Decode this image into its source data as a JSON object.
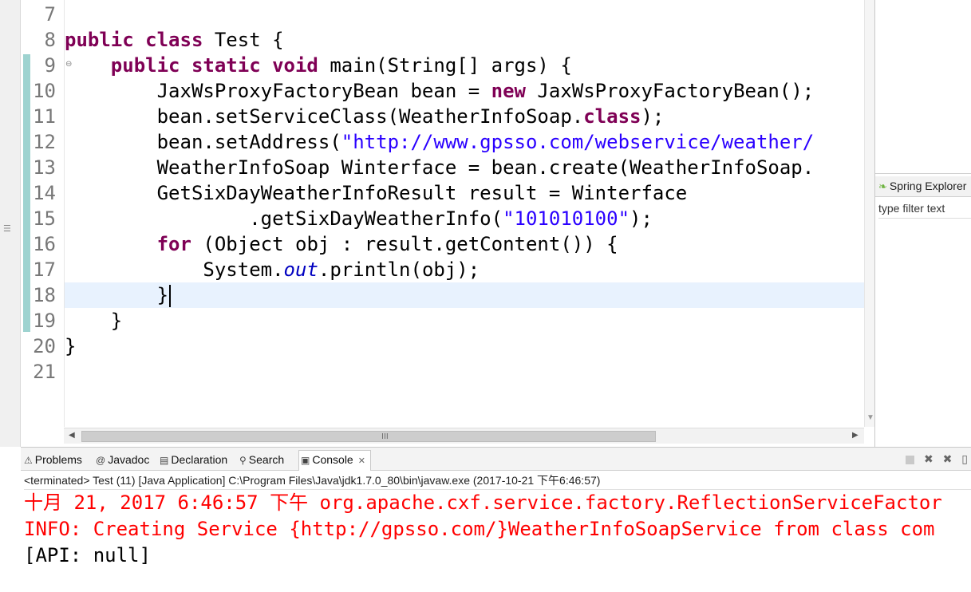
{
  "editor": {
    "lines": [
      {
        "num": "7",
        "segments": []
      },
      {
        "num": "8",
        "segments": [
          {
            "t": "public class",
            "c": "kw"
          },
          {
            "t": " Test {",
            "c": ""
          }
        ]
      },
      {
        "num": "9",
        "segments": [
          {
            "t": "    ",
            "c": ""
          },
          {
            "t": "public static void",
            "c": "kw"
          },
          {
            "t": " main(String[] args) {",
            "c": ""
          }
        ]
      },
      {
        "num": "10",
        "segments": [
          {
            "t": "        JaxWsProxyFactoryBean bean = ",
            "c": ""
          },
          {
            "t": "new",
            "c": "kw"
          },
          {
            "t": " JaxWsProxyFactoryBean();",
            "c": ""
          }
        ]
      },
      {
        "num": "11",
        "segments": [
          {
            "t": "        bean.setServiceClass(WeatherInfoSoap.",
            "c": ""
          },
          {
            "t": "class",
            "c": "kw"
          },
          {
            "t": ");",
            "c": ""
          }
        ]
      },
      {
        "num": "12",
        "segments": [
          {
            "t": "        bean.setAddress(",
            "c": ""
          },
          {
            "t": "\"http://www.gpsso.com/webservice/weather/",
            "c": "str"
          }
        ]
      },
      {
        "num": "13",
        "segments": [
          {
            "t": "        WeatherInfoSoap Winterface = bean.create(WeatherInfoSoap.",
            "c": ""
          }
        ]
      },
      {
        "num": "14",
        "segments": [
          {
            "t": "        GetSixDayWeatherInfoResult result = Winterface",
            "c": ""
          }
        ]
      },
      {
        "num": "15",
        "segments": [
          {
            "t": "                .getSixDayWeatherInfo(",
            "c": ""
          },
          {
            "t": "\"101010100\"",
            "c": "str"
          },
          {
            "t": ");",
            "c": ""
          }
        ]
      },
      {
        "num": "16",
        "segments": [
          {
            "t": "        ",
            "c": ""
          },
          {
            "t": "for",
            "c": "kw"
          },
          {
            "t": " (Object obj : result.getContent()) {",
            "c": ""
          }
        ]
      },
      {
        "num": "17",
        "segments": [
          {
            "t": "            System.",
            "c": ""
          },
          {
            "t": "out",
            "c": "fld"
          },
          {
            "t": ".println(obj);",
            "c": ""
          }
        ]
      },
      {
        "num": "18",
        "segments": [
          {
            "t": "        }",
            "c": ""
          }
        ],
        "current": true
      },
      {
        "num": "19",
        "segments": [
          {
            "t": "    }",
            "c": ""
          }
        ]
      },
      {
        "num": "20",
        "segments": [
          {
            "t": "}",
            "c": ""
          }
        ]
      },
      {
        "num": "21",
        "segments": []
      }
    ],
    "fold_marker": "⊖",
    "hscroll_grip": "III"
  },
  "right_panel": {
    "tab_label": "Spring Explorer",
    "filter_placeholder": "type filter text"
  },
  "bottom": {
    "tabs": [
      {
        "name": "tab-problems",
        "label": "Problems",
        "icon": "problems-icon",
        "glyph": "⚠"
      },
      {
        "name": "tab-javadoc",
        "label": "Javadoc",
        "icon": "javadoc-icon",
        "glyph": "@"
      },
      {
        "name": "tab-declaration",
        "label": "Declaration",
        "icon": "declaration-icon",
        "glyph": "▤"
      },
      {
        "name": "tab-search",
        "label": "Search",
        "icon": "search-icon",
        "glyph": "⚲"
      },
      {
        "name": "tab-console",
        "label": "Console",
        "icon": "console-icon",
        "glyph": "▣",
        "active": true
      }
    ],
    "close_glyph": "✕",
    "status": "<terminated> Test (11) [Java Application] C:\\Program Files\\Java\\jdk1.7.0_80\\bin\\javaw.exe (2017-10-21 下午6:46:57)",
    "console_lines": [
      {
        "text": "十月 21, 2017 6:46:57 下午 org.apache.cxf.service.factory.ReflectionServiceFactor",
        "color": "red"
      },
      {
        "text": "INFO: Creating Service {http://gpsso.com/}WeatherInfoSoapService from class com",
        "color": "red"
      },
      {
        "text": "[API: null]",
        "color": "black"
      }
    ]
  }
}
